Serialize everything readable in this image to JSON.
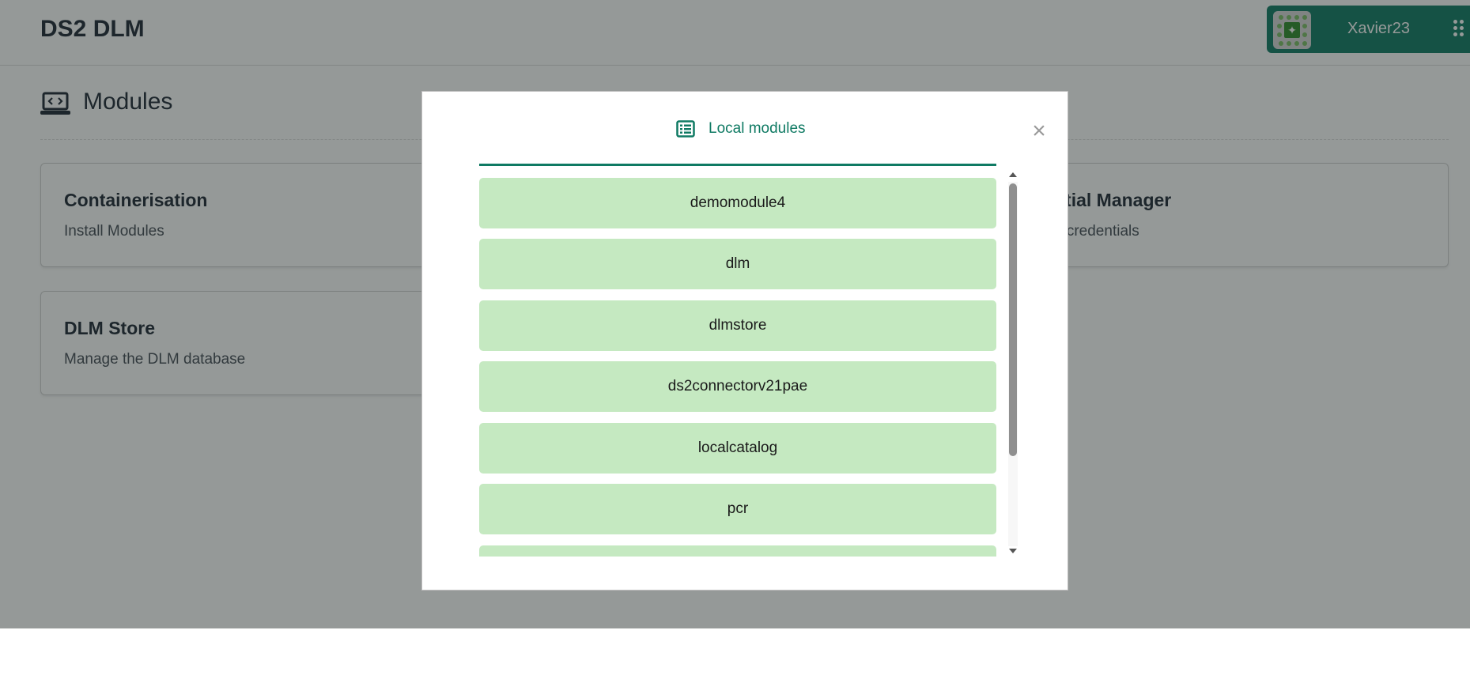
{
  "header": {
    "app_title": "DS2 DLM",
    "user_name": "Xavier23"
  },
  "page": {
    "title": "Modules"
  },
  "cards": [
    {
      "title": "Containerisation",
      "description": "Install Modules"
    },
    {
      "title": "ntial Manager",
      "description": "e credentials"
    },
    {
      "title": "DLM Store",
      "description": "Manage the DLM database"
    }
  ],
  "modal": {
    "tab_label": "Local modules",
    "close_label": "×",
    "modules": [
      "demomodule4",
      "dlm",
      "dlmstore",
      "ds2connectorv21pae",
      "localcatalog",
      "pcr",
      ""
    ]
  },
  "icons": {
    "laptop": "laptop-code-icon",
    "list": "list-icon",
    "close": "close-icon",
    "apps": "apps-grid-icon",
    "avatar": "avatar-icon"
  },
  "colors": {
    "brand": "#0f7a63",
    "module_bg": "#c5e9c1",
    "overlay": "rgba(30, 38, 36, 0.47)"
  },
  "scroll": {
    "thumb_fraction": 0.75,
    "position_fraction": 0.0
  }
}
